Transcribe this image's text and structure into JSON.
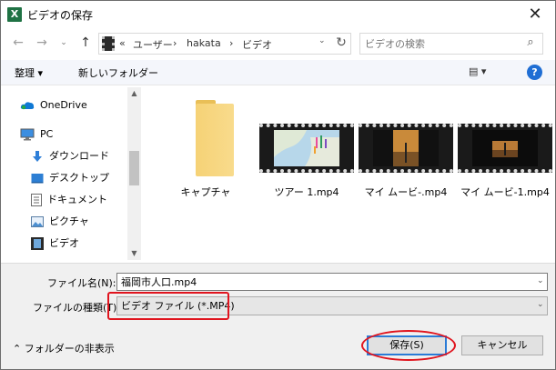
{
  "window": {
    "title": "ビデオの保存",
    "app_icon_letter": "X",
    "close_glyph": "✕"
  },
  "address": {
    "back_glyph": "←",
    "forward_glyph": "→",
    "up_glyph": "↑",
    "prefix": "«",
    "breadcrumbs": [
      "ユーザー",
      "hakata",
      "ビデオ"
    ],
    "separator": "›",
    "dropdown_glyph": "⌄",
    "refresh_glyph": "↻"
  },
  "search": {
    "placeholder": "ビデオの検索",
    "icon_glyph": "⌕"
  },
  "toolbar": {
    "organize_label": "整理 ▾",
    "new_folder_label": "新しいフォルダー",
    "view_glyph": "▤ ▾",
    "help_label": "?"
  },
  "sidebar": {
    "items": [
      {
        "label": "OneDrive",
        "icon": "onedrive-icon"
      },
      {
        "label": "PC",
        "icon": "pc-icon"
      },
      {
        "label": "ダウンロード",
        "icon": "download-icon"
      },
      {
        "label": "デスクトップ",
        "icon": "desktop-icon"
      },
      {
        "label": "ドキュメント",
        "icon": "document-icon"
      },
      {
        "label": "ピクチャ",
        "icon": "picture-icon"
      },
      {
        "label": "ビデオ",
        "icon": "video-icon"
      }
    ],
    "scroll_up_glyph": "▲",
    "scroll_down_glyph": "▼"
  },
  "files": [
    {
      "name": "キャプチャ",
      "type": "folder"
    },
    {
      "name": "ツアー 1.mp4",
      "type": "video"
    },
    {
      "name": "マイ ムービ-.mp4",
      "type": "video"
    },
    {
      "name": "マイ ムービ-1.mp4",
      "type": "video"
    }
  ],
  "form": {
    "filename_label": "ファイル名(N):",
    "filename_value": "福岡市人口.mp4",
    "filetype_label": "ファイルの種類(T):",
    "filetype_value": "ビデオ ファイル (*.MP4)",
    "dropdown_glyph": "⌄"
  },
  "buttons": {
    "hide_folders": "⌃ フォルダーの非表示",
    "save": "保存(S)",
    "cancel": "キャンセル"
  },
  "colors": {
    "highlight": "#e0141e",
    "accent": "#2a7bd6",
    "excel_green": "#1f7244"
  }
}
